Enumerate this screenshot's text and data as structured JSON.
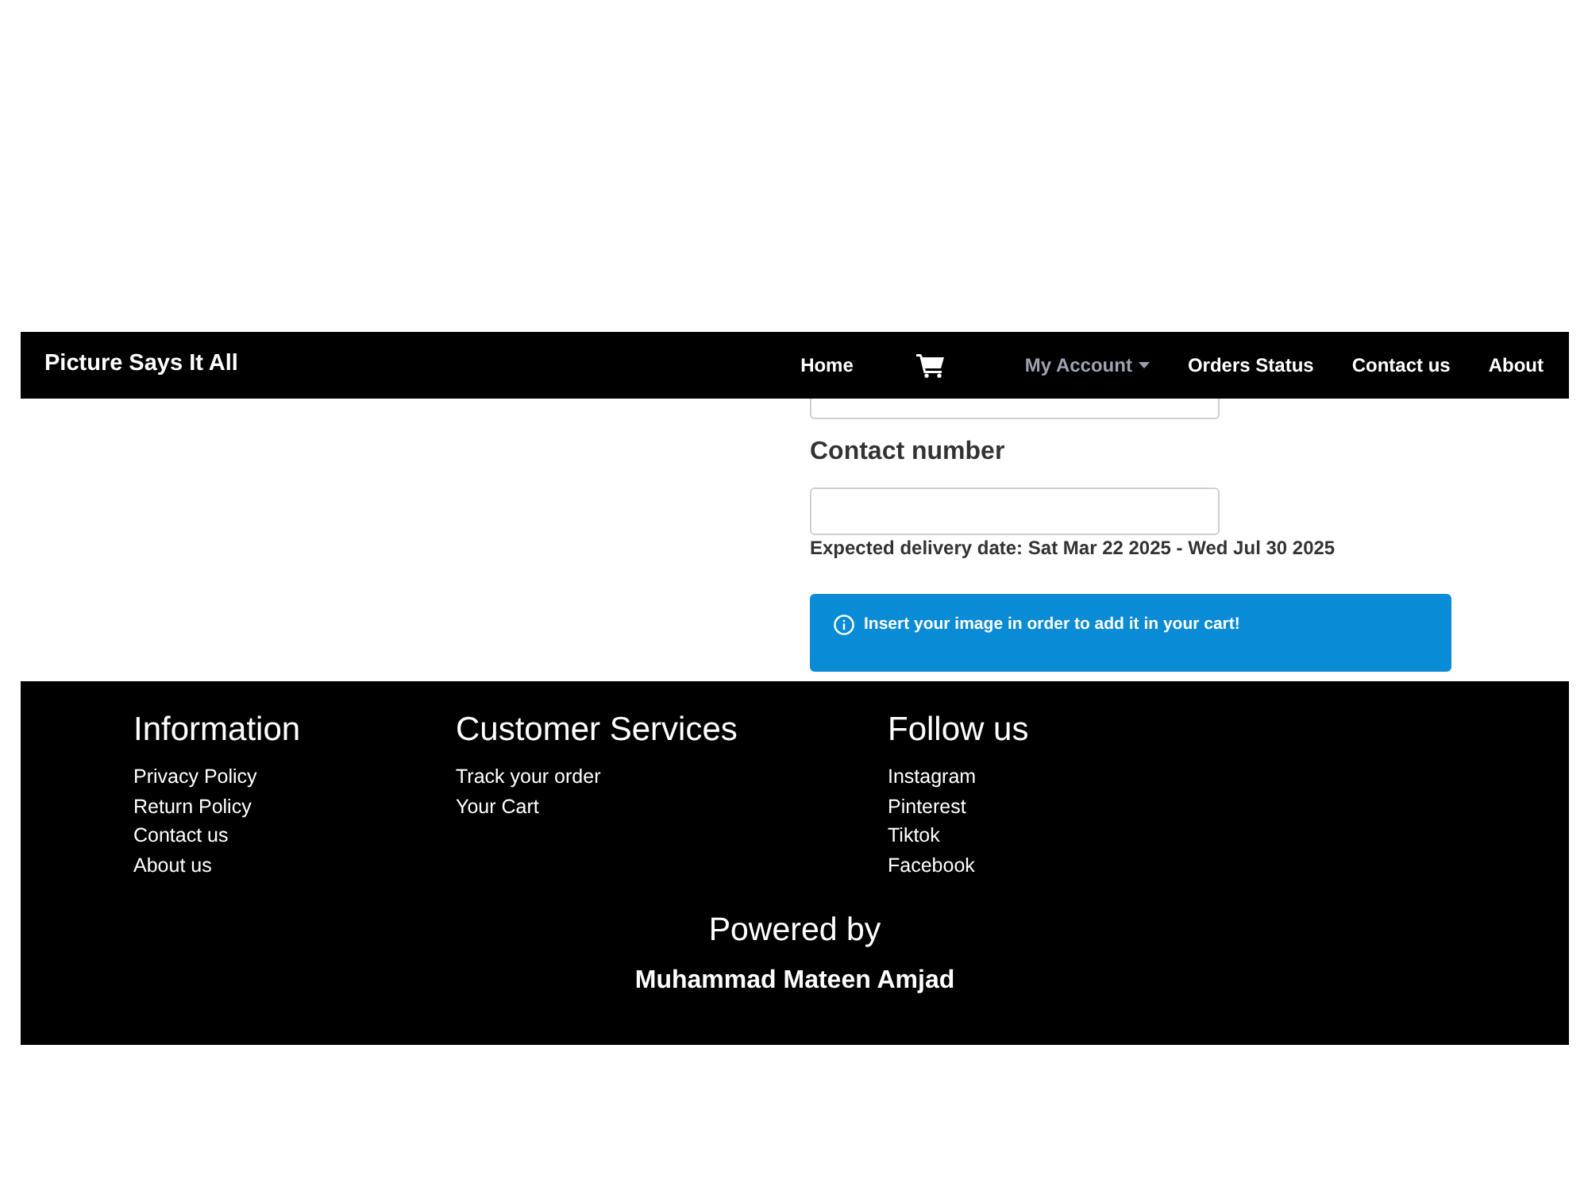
{
  "navbar": {
    "brand": "Picture Says It All",
    "items": [
      {
        "kind": "link",
        "label": "Home"
      },
      {
        "kind": "cart"
      },
      {
        "kind": "dropdown",
        "label": "My Account"
      },
      {
        "kind": "link",
        "label": "Orders Status"
      },
      {
        "kind": "link",
        "label": "Contact us"
      },
      {
        "kind": "link",
        "label": "About"
      }
    ]
  },
  "form": {
    "fields": [
      {
        "kind": "partial"
      },
      {
        "kind": "full",
        "label": "Contact number"
      }
    ],
    "delivery_note": "Expected delivery date: Sat Mar 22 2025 - Wed Jul 30 2025",
    "alert": {
      "kind": "info",
      "text": "Insert your image in order to add it in your cart!"
    }
  },
  "footer": {
    "columns": [
      {
        "heading": "Information",
        "links": [
          "Privacy Policy",
          "Return Policy",
          "Contact us",
          "About us"
        ]
      },
      {
        "heading": "Customer Services",
        "links": [
          "Track your order",
          "Your Cart"
        ]
      },
      {
        "heading": "Follow us",
        "links": [
          "Instagram",
          "Pinterest",
          "Tiktok",
          "Facebook"
        ]
      }
    ],
    "powered_by": {
      "label": "Powered by",
      "name": "Muhammad Mateen Amjad"
    }
  }
}
